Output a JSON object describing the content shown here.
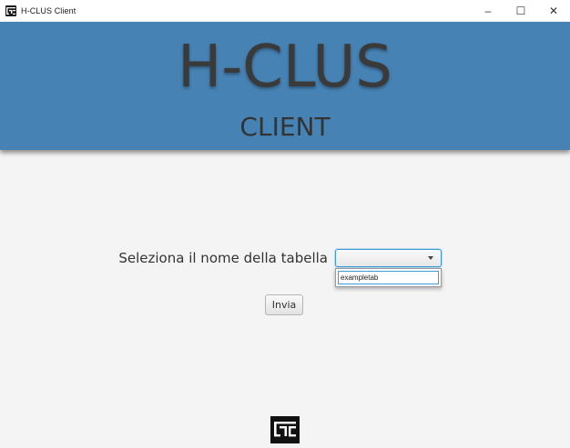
{
  "window": {
    "title": "H-CLUS Client",
    "controls": {
      "minimize": "–",
      "maximize": "☐",
      "close": "✕"
    }
  },
  "banner": {
    "brand": "H-CLUS",
    "subtitle": "CLIENT",
    "color": "#4682b4"
  },
  "form": {
    "label": "Seleziona il nome della tabella",
    "combo": {
      "selected": "",
      "options": [
        "exampletab"
      ]
    },
    "submit_label": "Invia"
  },
  "accent": "#3d9ad6",
  "icons": {
    "app": "app-logo-icon",
    "footer": "footer-logo-icon"
  }
}
